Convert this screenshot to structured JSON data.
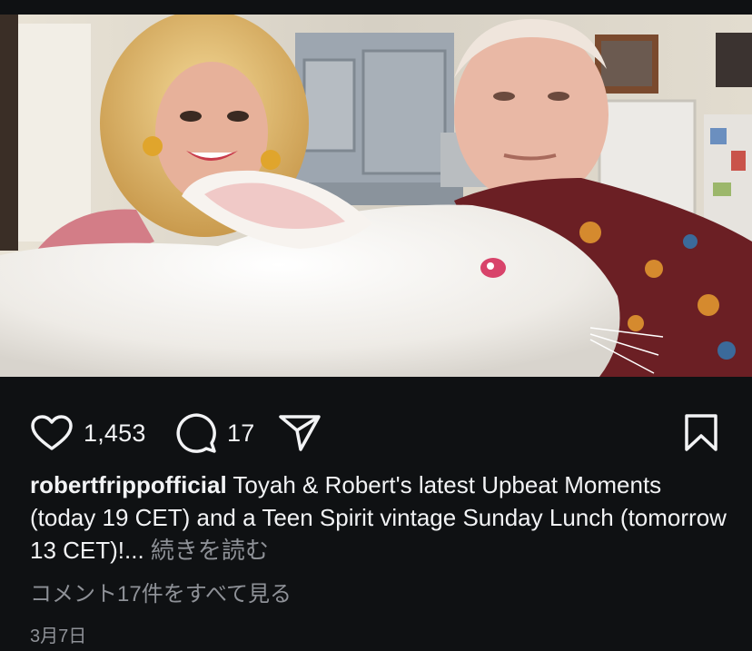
{
  "post": {
    "image": {
      "alt_icon": "post-photo",
      "palette": {
        "wall": "#d9d2c4",
        "cabinet": "#9aa3ad",
        "rabbit": "#f1eee9",
        "shirt": "#6b1f22",
        "hair": "#e6c27a"
      }
    },
    "actions": {
      "like_icon": "heart-icon",
      "like_count": "1,453",
      "comment_icon": "comment-icon",
      "comment_count": "17",
      "share_icon": "share-icon",
      "save_icon": "bookmark-icon"
    },
    "caption": {
      "username": "robertfrippofficial",
      "text": " Toyah & Robert's latest Upbeat Moments (today 19 CET) and a Teen Spirit vintage Sunday Lunch (tomorrow 13 CET)!...",
      "more_label": " 続きを読む"
    },
    "view_comments": "コメント17件をすべて見る",
    "date": "3月7日"
  }
}
